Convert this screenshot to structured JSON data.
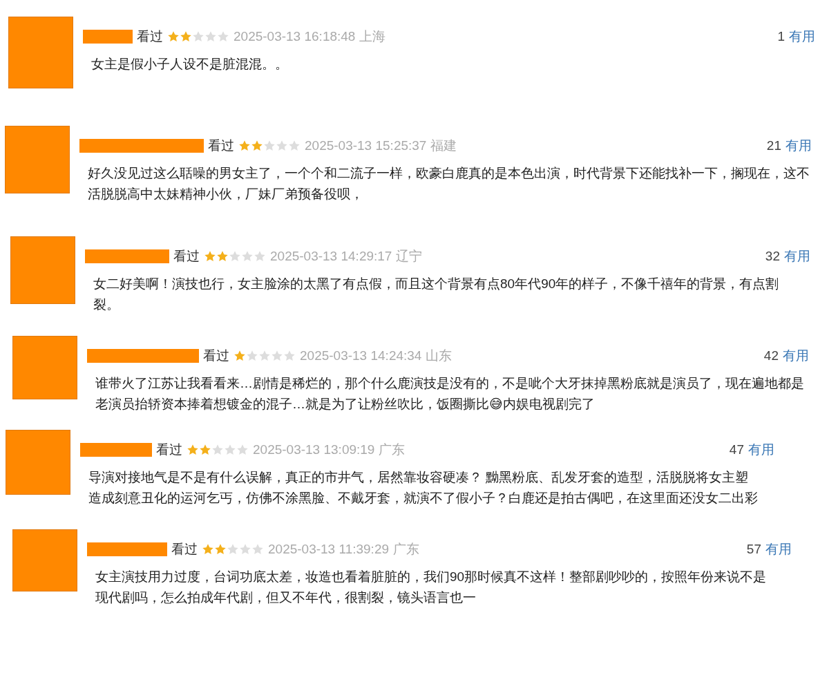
{
  "reviews": [
    {
      "status": "看过",
      "stars": 2,
      "time": "2025-03-13 16:18:48",
      "location": "上海",
      "votes": "1",
      "vote_label": "有用",
      "text": "女主是假小子人设不是脏混混。。"
    },
    {
      "status": "看过",
      "stars": 2,
      "time": "2025-03-13 15:25:37",
      "location": "福建",
      "votes": "21",
      "vote_label": "有用",
      "text": "好久没见过这么聒噪的男女主了，一个个和二流子一样，欧豪白鹿真的是本色出演，时代背景下还能找补一下，搁现在，这不活脱脱高中太妹精神小伙，厂妹厂弟预备役呗，"
    },
    {
      "status": "看过",
      "stars": 2,
      "time": "2025-03-13 14:29:17",
      "location": "辽宁",
      "votes": "32",
      "vote_label": "有用",
      "text": "女二好美啊！演技也行，女主脸涂的太黑了有点假，而且这个背景有点80年代90年的样子，不像千禧年的背景，有点割裂。"
    },
    {
      "status": "看过",
      "stars": 1,
      "time": "2025-03-13 14:24:34",
      "location": "山东",
      "votes": "42",
      "vote_label": "有用",
      "text": "谁带火了江苏让我看看来…剧情是稀烂的，那个什么鹿演技是没有的，不是呲个大牙抹掉黑粉底就是演员了，现在遍地都是老演员抬轿资本捧着想镀金的混子…就是为了让粉丝吹比，饭圈撕比😅内娱电视剧完了"
    },
    {
      "status": "看过",
      "stars": 2,
      "time": "2025-03-13 13:09:19",
      "location": "广东",
      "votes": "47",
      "vote_label": "有用",
      "text": "导演对接地气是不是有什么误解，真正的市井气，居然靠妆容硬凑？ 黝黑粉底、乱发牙套的造型，活脱脱将女主塑造成刻意丑化的运河乞丐，仿佛不涂黑脸、不戴牙套，就演不了假小子？白鹿还是拍古偶吧，在这里面还没女二出彩"
    },
    {
      "status": "看过",
      "stars": 2,
      "time": "2025-03-13 11:39:29",
      "location": "广东",
      "votes": "57",
      "vote_label": "有用",
      "text": "女主演技用力过度，台词功底太差，妆造也看着脏脏的，我们90那时候真不这样！整部剧吵吵的，按照年份来说不是现代剧吗，怎么拍成年代剧，但又不年代，很割裂，镜头语言也一"
    }
  ]
}
